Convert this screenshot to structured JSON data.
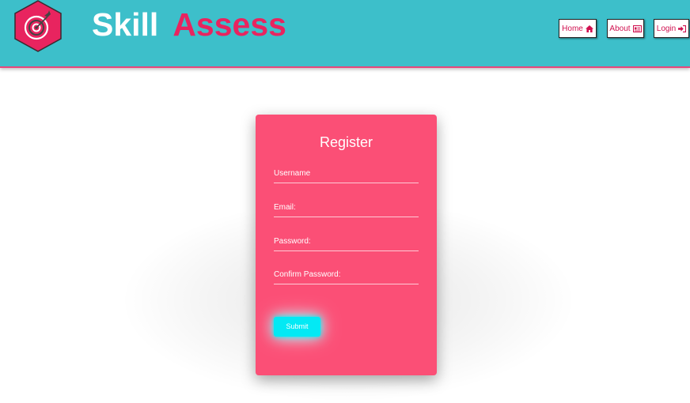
{
  "header": {
    "brand_word_1": "Skill",
    "brand_word_2": "Assess",
    "logo_icon": "target-dart-icon",
    "nav": {
      "home_label": "Home",
      "about_label": "About",
      "login_label": "Login"
    }
  },
  "register": {
    "title": "Register",
    "fields": [
      {
        "label": "Username",
        "value": ""
      },
      {
        "label": "Email:",
        "value": ""
      },
      {
        "label": "Password:",
        "value": ""
      },
      {
        "label": "Confirm Password:",
        "value": ""
      }
    ],
    "submit_label": "Submit"
  },
  "colors": {
    "header_bg": "#3dbfca",
    "brand_accent": "#e8245f",
    "card_bg": "#fb4f76",
    "submit_bg": "#03e9f4"
  }
}
